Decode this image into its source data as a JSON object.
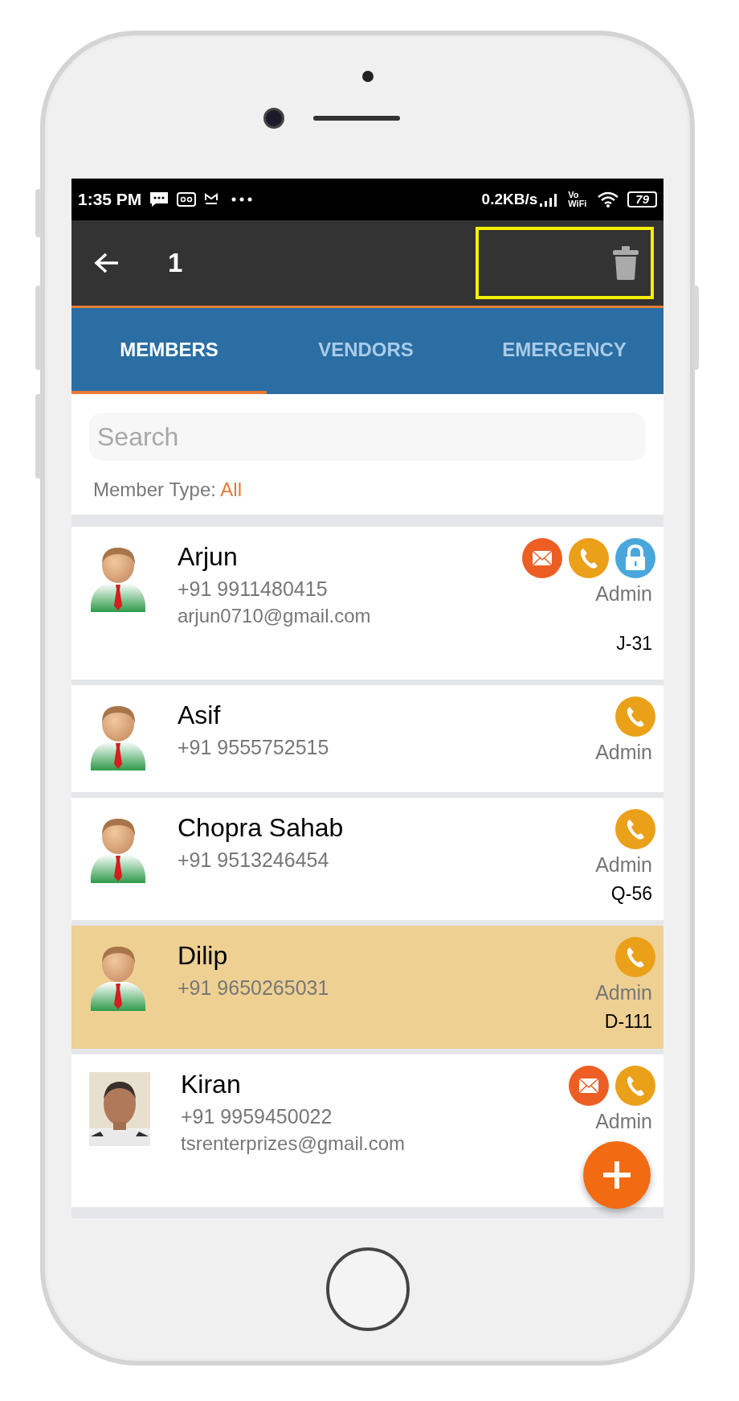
{
  "status_bar": {
    "time": "1:35 PM",
    "speed": "0.2KB/s",
    "vowifi": "Vo WiFi",
    "battery": "79"
  },
  "header": {
    "count": "1",
    "highlight_box": true
  },
  "tabs": [
    {
      "label": "MEMBERS",
      "selected": true
    },
    {
      "label": "VENDORS",
      "selected": false
    },
    {
      "label": "EMERGENCY",
      "selected": false
    }
  ],
  "search": {
    "placeholder": "Search"
  },
  "filter": {
    "label": "Member Type:",
    "value": "All"
  },
  "members": [
    {
      "name": "Arjun",
      "phone": "+91 9911480415",
      "email": "arjun0710@gmail.com",
      "role": "Admin",
      "unit": "J-31",
      "selected": false,
      "avatar": {
        "kind": "icon"
      },
      "actions": [
        {
          "kind": "email"
        },
        {
          "kind": "call"
        },
        {
          "kind": "lock"
        }
      ]
    },
    {
      "name": "Asif",
      "phone": "+91 9555752515",
      "role": "Admin",
      "selected": false,
      "avatar": {
        "kind": "icon"
      },
      "actions": [
        {
          "kind": "call"
        }
      ]
    },
    {
      "name": "Chopra Sahab",
      "phone": "+91 9513246454",
      "role": "Admin",
      "unit": "Q-56",
      "selected": false,
      "avatar": {
        "kind": "icon"
      },
      "actions": [
        {
          "kind": "call"
        }
      ]
    },
    {
      "name": "Dilip",
      "phone": "+91 9650265031",
      "role": "Admin",
      "unit": "D-111",
      "selected": true,
      "avatar": {
        "kind": "icon"
      },
      "actions": [
        {
          "kind": "call"
        }
      ]
    },
    {
      "name": "Kiran",
      "phone": "+91 9959450022",
      "email": "tsrenterprizes@gmail.com",
      "role": "Admin",
      "selected": false,
      "avatar": {
        "kind": "picture"
      },
      "actions": [
        {
          "kind": "email"
        },
        {
          "kind": "call"
        }
      ]
    }
  ]
}
